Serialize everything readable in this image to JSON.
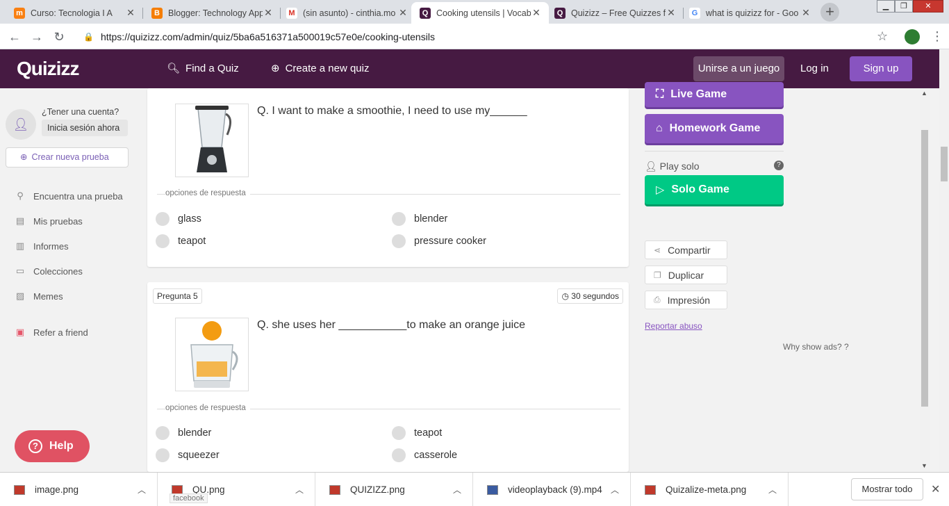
{
  "browser": {
    "tabs": [
      {
        "title": "Curso: Tecnologia I A",
        "icon": "moodle-icon"
      },
      {
        "title": "Blogger: Technology App",
        "icon": "blogger-icon"
      },
      {
        "title": "(sin asunto) - cinthia.mo",
        "icon": "gmail-icon"
      },
      {
        "title": "Cooking utensils | Vocab",
        "icon": "quizizz-icon"
      },
      {
        "title": "Quizizz – Free Quizzes fo",
        "icon": "quizizz-icon"
      },
      {
        "title": "what is quizizz for - Goo",
        "icon": "google-icon"
      }
    ],
    "url": "https://quizizz.com/admin/quiz/5ba6a516371a500019c57e0e/cooking-utensils"
  },
  "header": {
    "logo": "Quizizz",
    "find_quiz": "Find a Quiz",
    "create_quiz": "Create a new quiz",
    "join": "Unirse a un juego",
    "login": "Log in",
    "signup": "Sign up"
  },
  "sidebar": {
    "account_question": "¿Tener una cuenta?",
    "login_now": "Inicia sesión ahora",
    "new_quiz": "Crear nueva prueba",
    "items": [
      {
        "label": "Encuentra una prueba",
        "icon": "search-icon"
      },
      {
        "label": "Mis pruebas",
        "icon": "document-icon"
      },
      {
        "label": "Informes",
        "icon": "chart-icon"
      },
      {
        "label": "Colecciones",
        "icon": "folder-icon"
      },
      {
        "label": "Memes",
        "icon": "image-icon"
      }
    ],
    "refer": "Refer a friend",
    "help": "Help"
  },
  "questions": [
    {
      "text": "Q. I want to make a smoothie, I need to use my______",
      "options_label": "opciones de respuesta",
      "options": [
        "glass",
        "blender",
        "teapot",
        "pressure cooker"
      ]
    },
    {
      "number": "Pregunta 5",
      "time": "30 segundos",
      "text": "Q. she uses her ___________to make an orange juice",
      "options_label": "opciones de respuesta",
      "options": [
        "blender",
        "teapot",
        "squeezer",
        "casserole"
      ]
    }
  ],
  "right_panel": {
    "live_game": "Live Game",
    "homework_game": "Homework Game",
    "play_solo": "Play solo",
    "solo_game": "Solo Game",
    "share": "Compartir",
    "duplicate": "Duplicar",
    "print": "Impresión",
    "report": "Reportar abuso",
    "why_ads": "Why show ads?"
  },
  "downloads": {
    "files": [
      "image.png",
      "QU.png",
      "QUIZIZZ.png",
      "videoplayback (9).mp4",
      "Quizalize-meta.png"
    ],
    "show_all": "Mostrar todo",
    "tooltip": "facebook"
  }
}
